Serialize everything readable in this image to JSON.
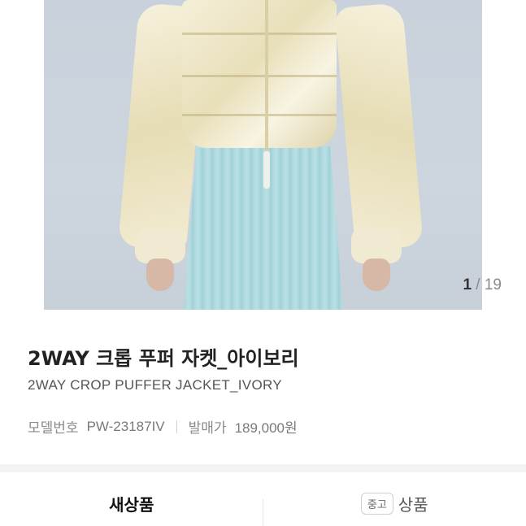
{
  "gallery": {
    "current": "1",
    "separator": "/",
    "total": "19"
  },
  "product": {
    "title": "2WAY 크롭 푸퍼 자켓_아이보리",
    "subtitle": "2WAY CROP PUFFER JACKET_IVORY",
    "model_label": "모델번호",
    "model_value": "PW-23187IV",
    "price_label": "발매가",
    "price_value": "189,000원"
  },
  "tabs": {
    "new_label": "새상품",
    "used_badge": "중고",
    "used_label": "상품"
  }
}
